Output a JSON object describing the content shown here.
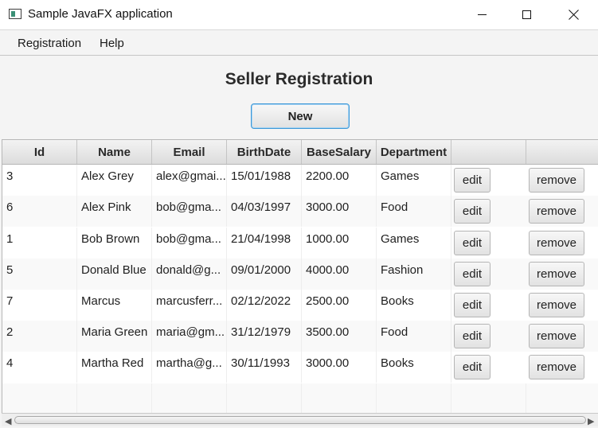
{
  "window": {
    "title": "Sample JavaFX application"
  },
  "menu": [
    "Registration",
    "Help"
  ],
  "page": {
    "title": "Seller Registration",
    "new_label": "New"
  },
  "table": {
    "columns": [
      "Id",
      "Name",
      "Email",
      "BirthDate",
      "BaseSalary",
      "Department",
      "",
      ""
    ],
    "rows": [
      {
        "id": "3",
        "name": "Alex Grey",
        "email": "alex@gmai...",
        "birthdate": "15/01/1988",
        "salary": "2200.00",
        "department": "Games"
      },
      {
        "id": "6",
        "name": "Alex Pink",
        "email": "bob@gma...",
        "birthdate": "04/03/1997",
        "salary": "3000.00",
        "department": "Food"
      },
      {
        "id": "1",
        "name": "Bob Brown",
        "email": "bob@gma...",
        "birthdate": "21/04/1998",
        "salary": "1000.00",
        "department": "Games"
      },
      {
        "id": "5",
        "name": "Donald Blue",
        "email": "donald@g...",
        "birthdate": "09/01/2000",
        "salary": "4000.00",
        "department": "Fashion"
      },
      {
        "id": "7",
        "name": "Marcus",
        "email": "marcusferr...",
        "birthdate": "02/12/2022",
        "salary": "2500.00",
        "department": "Books"
      },
      {
        "id": "2",
        "name": "Maria Green",
        "email": "maria@gm...",
        "birthdate": "31/12/1979",
        "salary": "3500.00",
        "department": "Food"
      },
      {
        "id": "4",
        "name": "Martha Red",
        "email": "martha@g...",
        "birthdate": "30/11/1993",
        "salary": "3000.00",
        "department": "Books"
      }
    ],
    "edit_label": "edit",
    "remove_label": "remove"
  }
}
